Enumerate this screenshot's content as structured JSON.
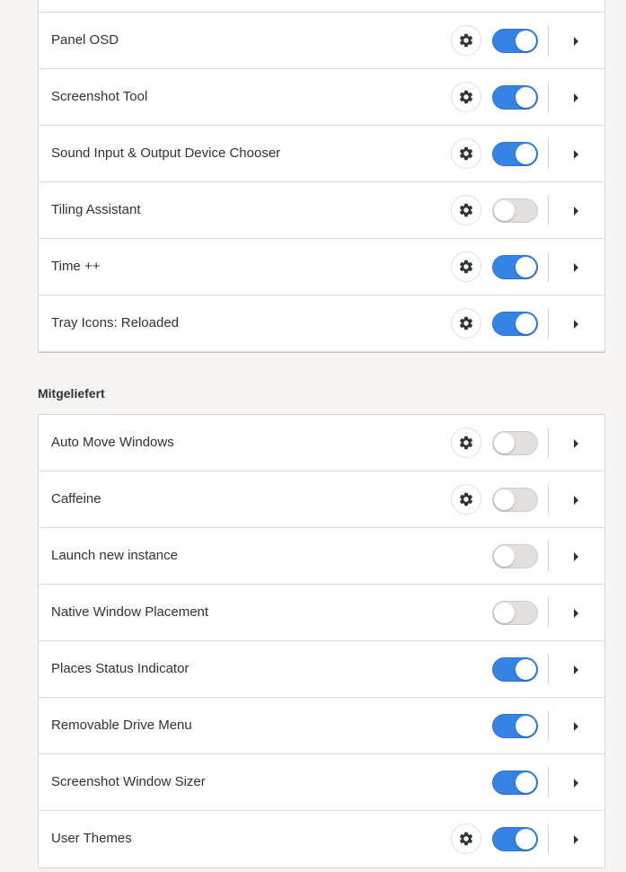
{
  "sections": {
    "user_title": "",
    "system_title": "Mitgeliefert"
  },
  "user_extensions": [
    {
      "name": "Panel OSD",
      "has_settings": true,
      "enabled": true
    },
    {
      "name": "Screenshot Tool",
      "has_settings": true,
      "enabled": true
    },
    {
      "name": "Sound Input & Output Device Chooser",
      "has_settings": true,
      "enabled": true
    },
    {
      "name": "Tiling Assistant",
      "has_settings": true,
      "enabled": false
    },
    {
      "name": "Time ++",
      "has_settings": true,
      "enabled": true
    },
    {
      "name": "Tray Icons: Reloaded",
      "has_settings": true,
      "enabled": true
    }
  ],
  "system_extensions": [
    {
      "name": "Auto Move Windows",
      "has_settings": true,
      "enabled": false
    },
    {
      "name": "Caffeine",
      "has_settings": true,
      "enabled": false
    },
    {
      "name": "Launch new instance",
      "has_settings": false,
      "enabled": false
    },
    {
      "name": "Native Window Placement",
      "has_settings": false,
      "enabled": false
    },
    {
      "name": "Places Status Indicator",
      "has_settings": false,
      "enabled": true
    },
    {
      "name": "Removable Drive Menu",
      "has_settings": false,
      "enabled": true
    },
    {
      "name": "Screenshot Window Sizer",
      "has_settings": false,
      "enabled": true
    },
    {
      "name": "User Themes",
      "has_settings": true,
      "enabled": true
    }
  ],
  "icons": {
    "settings": "gear-icon",
    "expand": "chevron-right-icon"
  },
  "colors": {
    "switch_on": "#3584e4",
    "switch_off": "#e2e0dd",
    "background": "#f6f5f4"
  }
}
